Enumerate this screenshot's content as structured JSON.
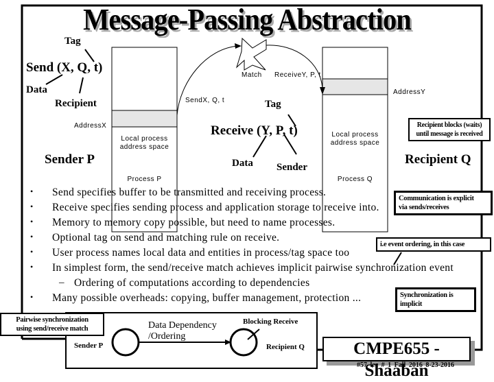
{
  "title": "Message-Passing Abstraction",
  "send_expr": {
    "label": "Send (X, Q, t)",
    "annotations": {
      "tag": "Tag",
      "data": "Data",
      "recipient": "Recipient"
    }
  },
  "receive_expr": {
    "label": "Receive (Y, P, t)",
    "annotations": {
      "tag": "Tag",
      "data": "Data",
      "sender": "Sender"
    }
  },
  "sender_label": "Sender P",
  "recipient_label": "Recipient Q",
  "process_p": {
    "caption": "Process P",
    "address_label": "AddressX",
    "space_label_1": "Local process",
    "space_label_2": "address space"
  },
  "process_q": {
    "caption": "Process Q",
    "address_label": "AddressY",
    "space_label_1": "Local process",
    "space_label_2": "address space"
  },
  "arrows": {
    "send_label": "SendX, Q, t",
    "receive_label": "ReceiveY, P, t",
    "match_label": "Match"
  },
  "bullets": [
    {
      "level": 1,
      "text": "Send specifies buffer to be transmitted and receiving process."
    },
    {
      "level": 1,
      "text": "Receive specifies sending process and application storage to receive into."
    },
    {
      "level": 1,
      "text": "Memory to memory copy possible, but need to name processes."
    },
    {
      "level": 1,
      "text": "Optional tag on send and matching rule on receive."
    },
    {
      "level": 1,
      "text": "User process names local data and entities in process/tag space too"
    },
    {
      "level": 1,
      "text": "In simplest form, the send/receive match achieves implicit pairwise synchronization event"
    },
    {
      "level": 2,
      "text": "Ordering of computations according to dependencies"
    },
    {
      "level": 1,
      "text": "Many possible overheads: copying, buffer management, protection ..."
    }
  ],
  "bullet_glyph": "•",
  "sub_bullet_glyph": "–",
  "notes": {
    "recipient_blocks": [
      "Recipient blocks (waits)",
      "until message is received"
    ],
    "communication_explicit": [
      "Communication is explicit",
      "via sends/receives"
    ],
    "event_ordering": [
      "i.e event ordering, in this case"
    ],
    "sync_implicit": [
      "Synchronization is",
      "implicit"
    ],
    "pairwise_sync": [
      "Pairwise synchronization",
      "using send/receive match"
    ]
  },
  "sync_diagram": {
    "sender": "Sender P",
    "recipient": "Recipient Q",
    "dependency_1": "Data Dependency",
    "dependency_2": "/Ordering",
    "blocking": "Blocking Receive"
  },
  "footer": {
    "brand": "CMPE655 - Shaaban",
    "meta": "#57  lec # 1   Fall 2016   8-23-2016"
  },
  "colors": {
    "address_fill": "#e6e6e6",
    "shadow": "#999999"
  }
}
